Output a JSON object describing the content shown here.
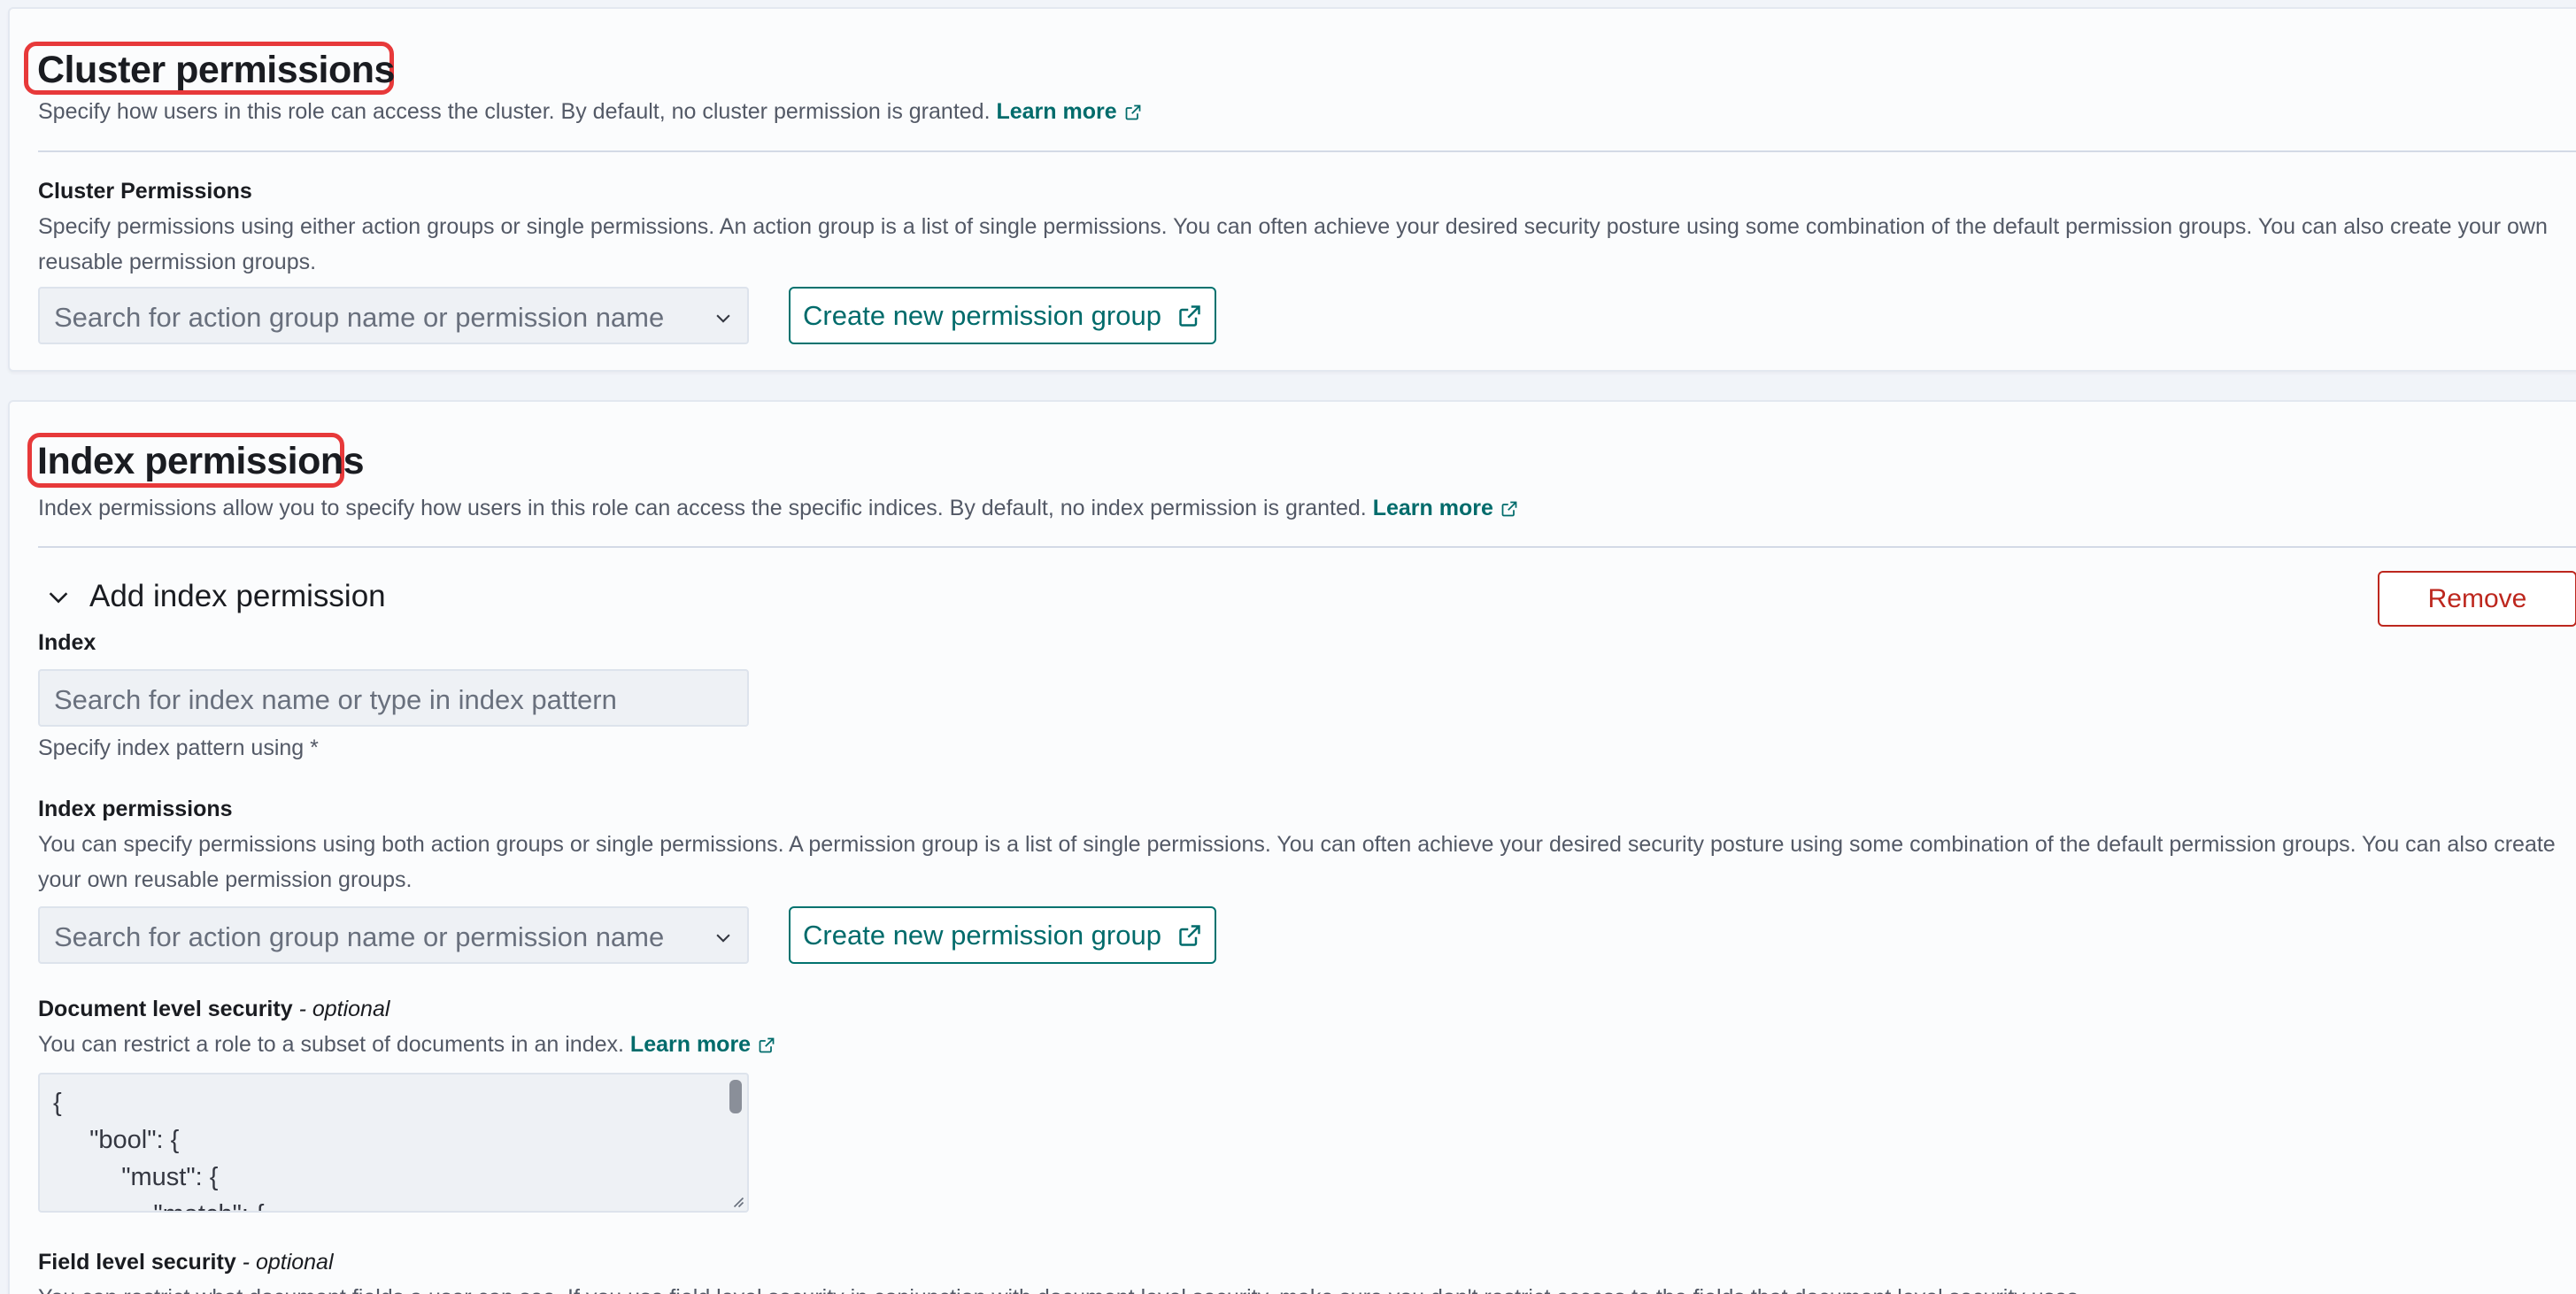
{
  "cluster": {
    "title": "Cluster permissions",
    "description": "Specify how users in this role can access the cluster. By default, no cluster permission is granted.",
    "learn_more": "Learn more",
    "field_label": "Cluster Permissions",
    "field_help": "Specify permissions using either action groups or single permissions. An action group is a list of single permissions. You can often achieve your desired security posture using some combination of the default permission groups. You can also create your own reusable permission groups.",
    "search_placeholder": "Search for action group name or permission name",
    "create_button": "Create new permission group"
  },
  "index": {
    "title": "Index permissions",
    "description": "Index permissions allow you to specify how users in this role can access the specific indices. By default, no index permission is granted.",
    "learn_more": "Learn more",
    "accordion_title": "Add index permission",
    "remove_button": "Remove",
    "index_label": "Index",
    "index_placeholder": "Search for index name or type in index pattern",
    "index_help": "Specify index pattern using *",
    "perm_label": "Index permissions",
    "perm_help": "You can specify permissions using both action groups or single permissions. A permission group is a list of single permissions. You can often achieve your desired security posture using some combination of the default permission groups. You can also create your own reusable permission groups.",
    "search_placeholder": "Search for action group name or permission name",
    "create_button": "Create new permission group",
    "dls_label": "Document level security",
    "dls_optional": "- optional",
    "dls_help": "You can restrict a role to a subset of documents in an index.",
    "dls_learn_more": "Learn more",
    "dls_code": [
      "{",
      "  \"bool\": {",
      "    \"must\": {",
      "      \"match\": {"
    ],
    "fls_label": "Field level security",
    "fls_optional": "- optional",
    "fls_help": "You can restrict what document fields a user can see. If you use field level security in conjunction with document level security, make sure you don't restrict access to the fields that document level security uses."
  },
  "colors": {
    "accent": "#006b6b",
    "danger": "#bd271e",
    "highlight": "#e7393a"
  }
}
